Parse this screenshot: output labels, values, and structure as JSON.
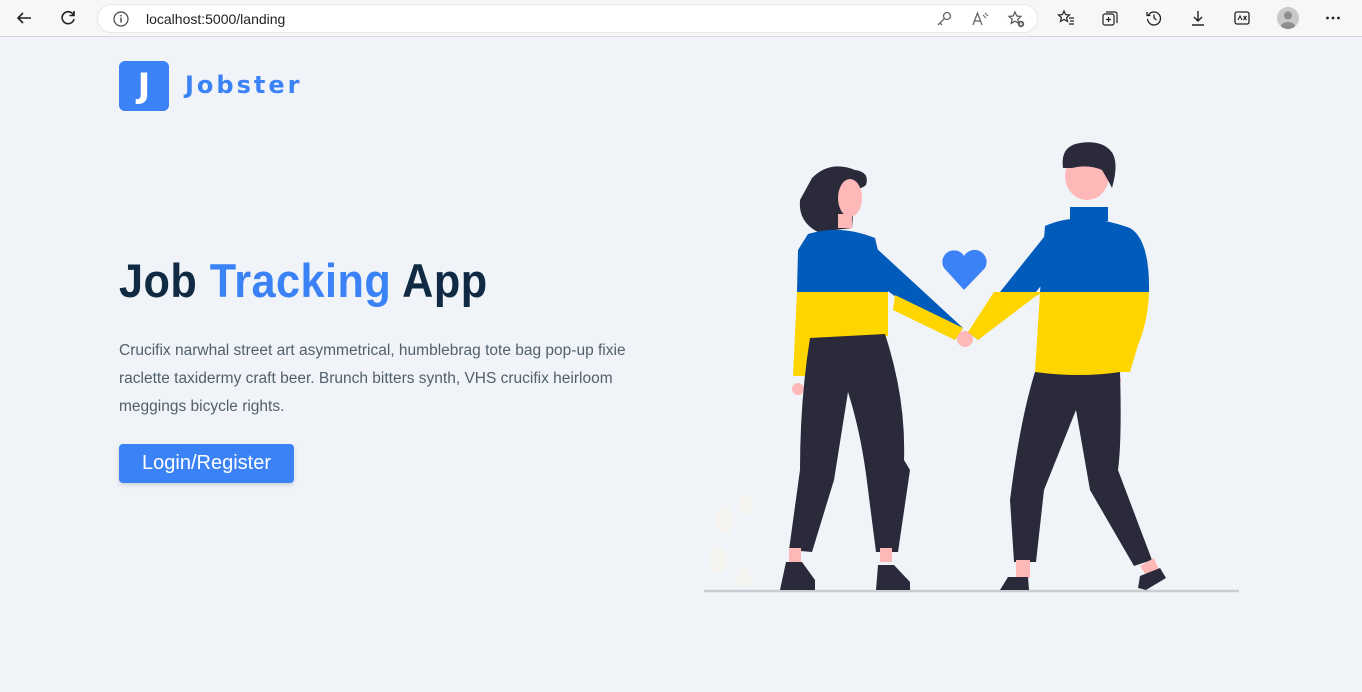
{
  "browser": {
    "url": "localhost:5000/landing"
  },
  "page": {
    "logo_letter": "J",
    "logo_name": "Jobster",
    "hero": {
      "title_start": "Job ",
      "title_accent": "Tracking",
      "title_end": " App",
      "description": "Crucifix narwhal street art asymmetrical, humblebrag tote bag pop-up fixie raclette taxidermy craft beer. Brunch bitters synth, VHS crucifix heirloom meggings bicycle rights.",
      "cta_label": "Login/Register"
    }
  },
  "colors": {
    "primary": "#3b82f6",
    "heading": "#102a43",
    "background": "#f0f4f8",
    "sweater_blue": "#005bbb",
    "sweater_yellow": "#ffd500"
  }
}
